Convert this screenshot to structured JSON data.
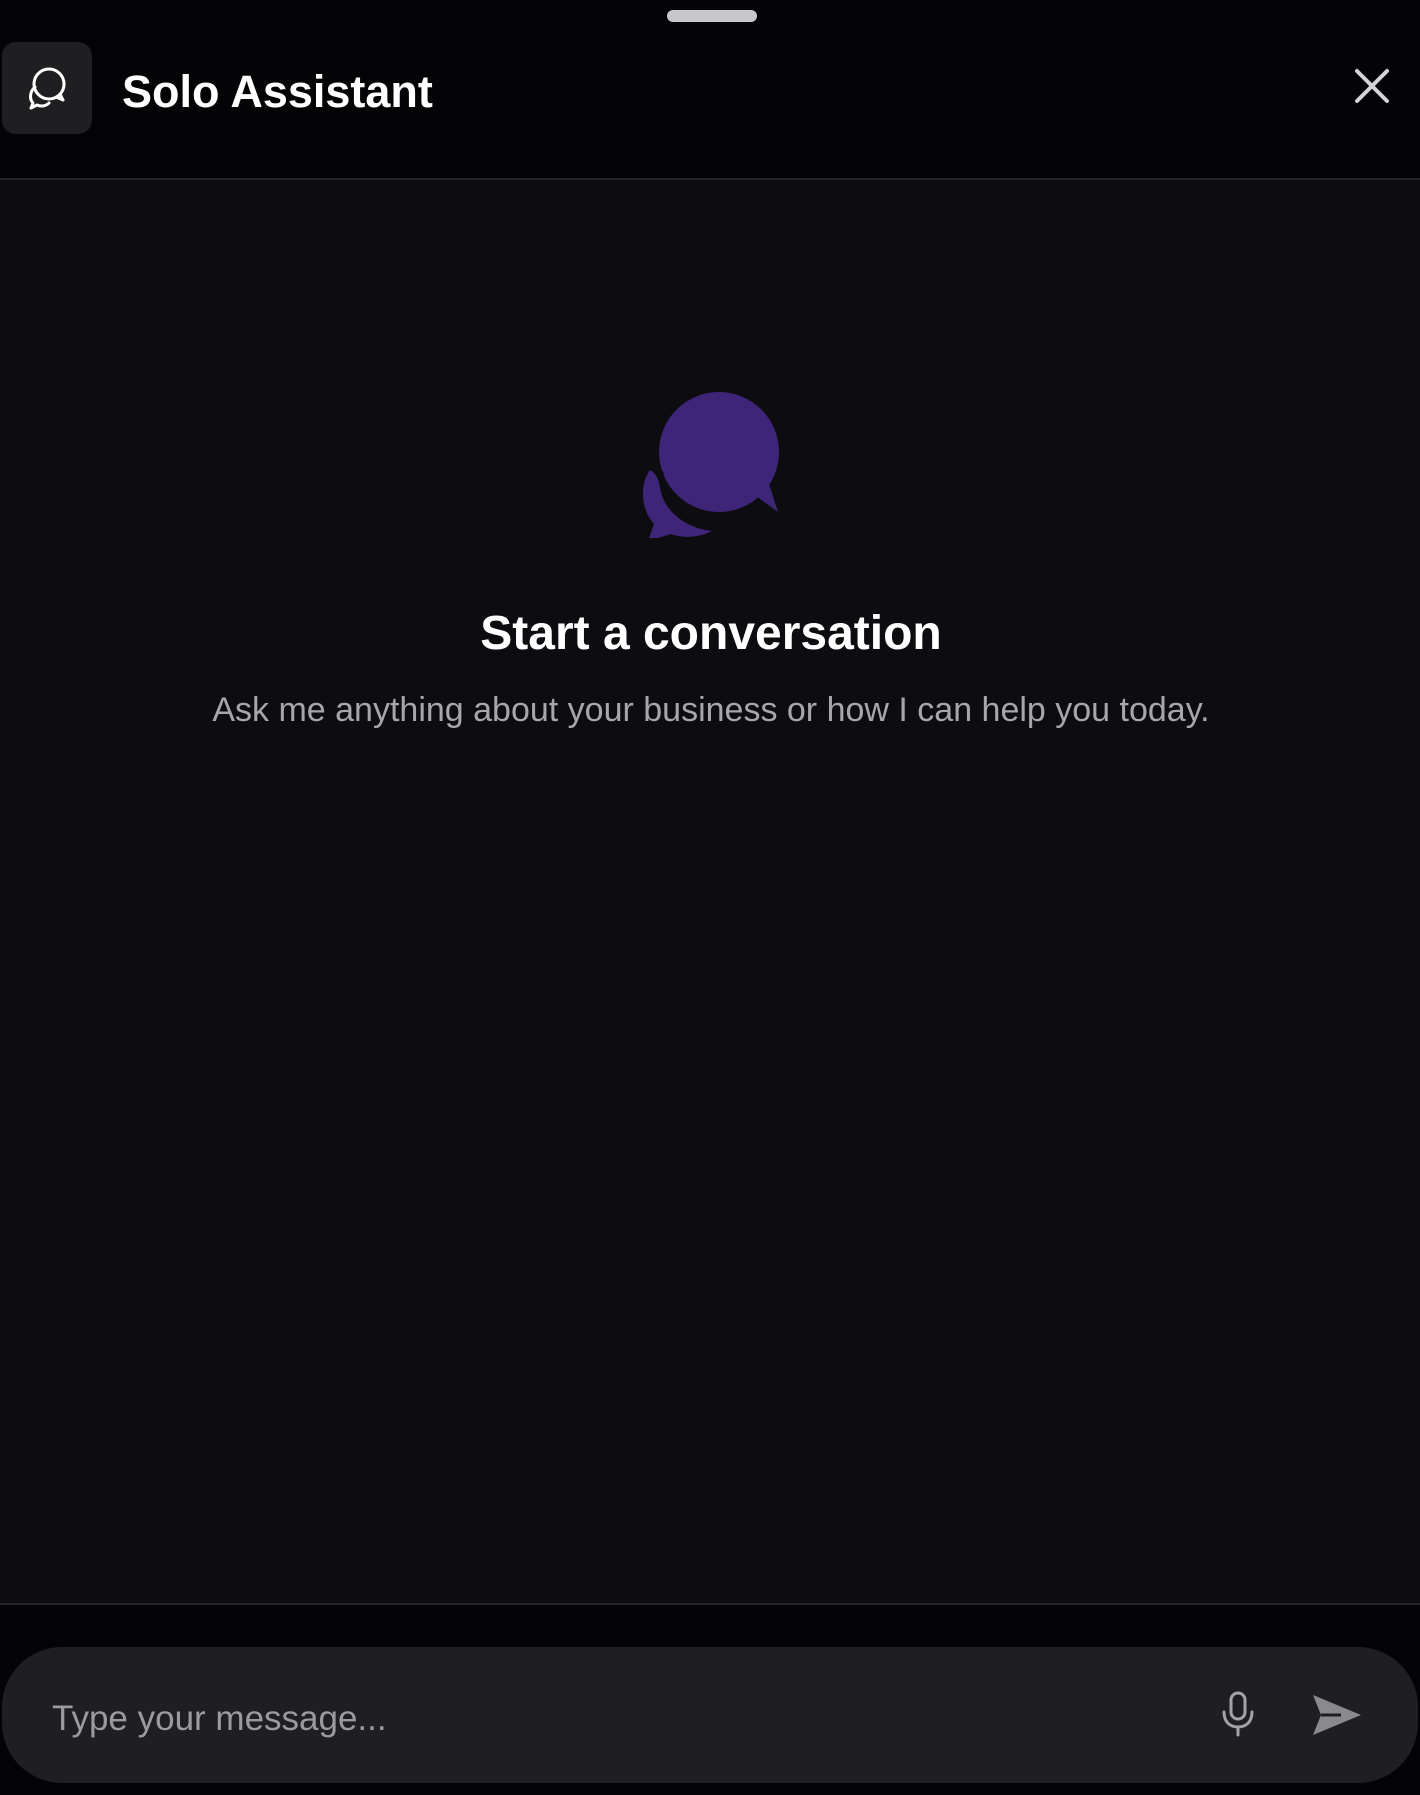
{
  "header": {
    "title": "Solo Assistant",
    "logo_icon": "chat-bubbles-outline-icon",
    "close_icon": "close-icon",
    "drag_handle": "drag-handle"
  },
  "empty_state": {
    "icon": "chat-bubbles-icon",
    "icon_color": "#3f2578",
    "title": "Start a conversation",
    "subtitle": "Ask me anything about your business or how I can help you today."
  },
  "composer": {
    "placeholder": "Type your message...",
    "value": "",
    "mic_icon": "microphone-icon",
    "send_icon": "send-icon"
  },
  "colors": {
    "background": "#0c0c11",
    "header_background": "#040406",
    "composer_background": "#1f1f21",
    "accent": "#3f2578"
  }
}
